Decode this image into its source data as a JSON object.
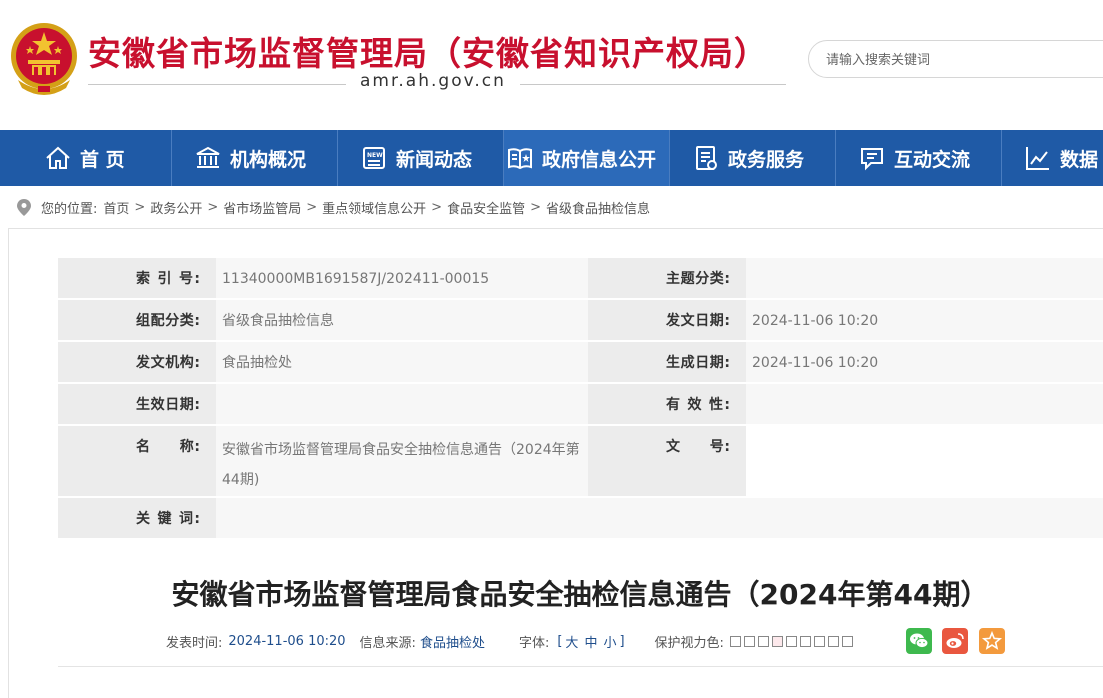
{
  "header": {
    "site_title": "安徽省市场监督管理局（安徽省知识产权局）",
    "domain": "amr.ah.gov.cn",
    "search_placeholder": "请输入搜索关键词",
    "brand_color": "#c8102e"
  },
  "nav": {
    "color": "#1f5aa6",
    "items": [
      {
        "label": "首 页",
        "icon": "home-icon"
      },
      {
        "label": "机构概况",
        "icon": "building-icon"
      },
      {
        "label": "新闻动态",
        "icon": "news-icon"
      },
      {
        "label": "政府信息公开",
        "icon": "open-book-icon"
      },
      {
        "label": "政务服务",
        "icon": "service-document-icon"
      },
      {
        "label": "互动交流",
        "icon": "chat-icon"
      },
      {
        "label": "数据",
        "icon": "chart-icon"
      }
    ]
  },
  "breadcrumb": {
    "prefix": "您的位置:",
    "items": [
      "首页",
      "政务公开",
      "省市场监管局",
      "重点领域信息公开",
      "食品安全监管",
      "省级食品抽检信息"
    ],
    "separator": ">"
  },
  "meta": {
    "index_label": "索 引 号:",
    "index_value": "11340000MB1691587J/202411-00015",
    "topic_label": "主题分类:",
    "topic_value": "",
    "category_label": "组配分类:",
    "category_value": "省级食品抽检信息",
    "issue_date_label": "发文日期:",
    "issue_date_value": "2024-11-06 10:20",
    "org_label": "发文机构:",
    "org_value": "食品抽检处",
    "created_label": "生成日期:",
    "created_value": "2024-11-06 10:20",
    "effective_label": "生效日期:",
    "effective_value": "",
    "validity_label": "有 效 性:",
    "validity_value": "",
    "name_label": "名　　称:",
    "name_value": "安徽省市场监督管理局食品安全抽检信息通告（2024年第44期)",
    "doc_no_label": "文　　号:",
    "doc_no_value": "",
    "keywords_label": "关 键 词:",
    "keywords_value": ""
  },
  "article": {
    "title": "安徽省市场监督管理局食品安全抽检信息通告（2024年第44期）",
    "publish_label": "发表时间:",
    "publish_value": "2024-11-06 10:20",
    "source_label": "信息来源:",
    "source_value": "食品抽检处",
    "font_label": "字体:",
    "font_open": "[",
    "font_large": "大",
    "font_medium": "中",
    "font_small": "小",
    "font_close": "]",
    "eye_care_label": "保护视力色:",
    "swatch_colors": [
      "#ffffff",
      "#ffffff",
      "#ffffff",
      "#fde9ec",
      "#ffffff",
      "#ffffff",
      "#ffffff",
      "#ffffff",
      "#ffffff"
    ],
    "share": [
      {
        "icon": "wechat-icon",
        "color": "#3eb94e"
      },
      {
        "icon": "weibo-icon",
        "color": "#e9573f"
      },
      {
        "icon": "favorite-star-icon",
        "color": "#f39a3d"
      }
    ]
  }
}
